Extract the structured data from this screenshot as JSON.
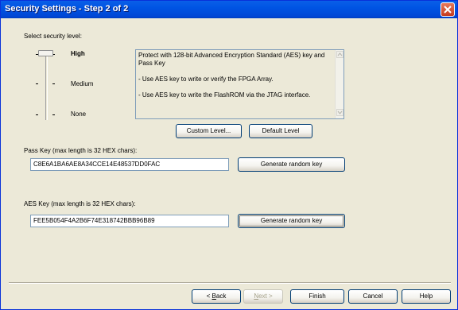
{
  "window": {
    "title": "Security Settings - Step 2 of 2"
  },
  "security_level": {
    "label": "Select security level:",
    "levels": [
      "High",
      "Medium",
      "None"
    ],
    "selected": "High",
    "description": [
      "Protect with 128-bit Advanced Encryption Standard (AES) key and Pass Key",
      "- Use AES key to write or verify the FPGA Array.",
      "- Use AES key to write the FlashROM via the JTAG interface."
    ],
    "custom_level_label": "Custom Level...",
    "default_level_label": "Default Level"
  },
  "pass_key": {
    "label": "Pass Key (max length is 32 HEX chars):",
    "value": "C8E6A1BA6AE8A34CCE14E48537DD0FAC",
    "generate_label": "Generate random key"
  },
  "aes_key": {
    "label": "AES Key (max length is 32 HEX chars):",
    "value": "FEE5B054F4A2B6F74E318742BBB96B89",
    "generate_label": "Generate random key"
  },
  "footer": {
    "back_prefix": "< ",
    "back_underline": "B",
    "back_rest": "ack",
    "next_underline": "N",
    "next_rest": "ext >",
    "finish_label": "Finish",
    "cancel_label": "Cancel",
    "help_label": "Help"
  }
}
